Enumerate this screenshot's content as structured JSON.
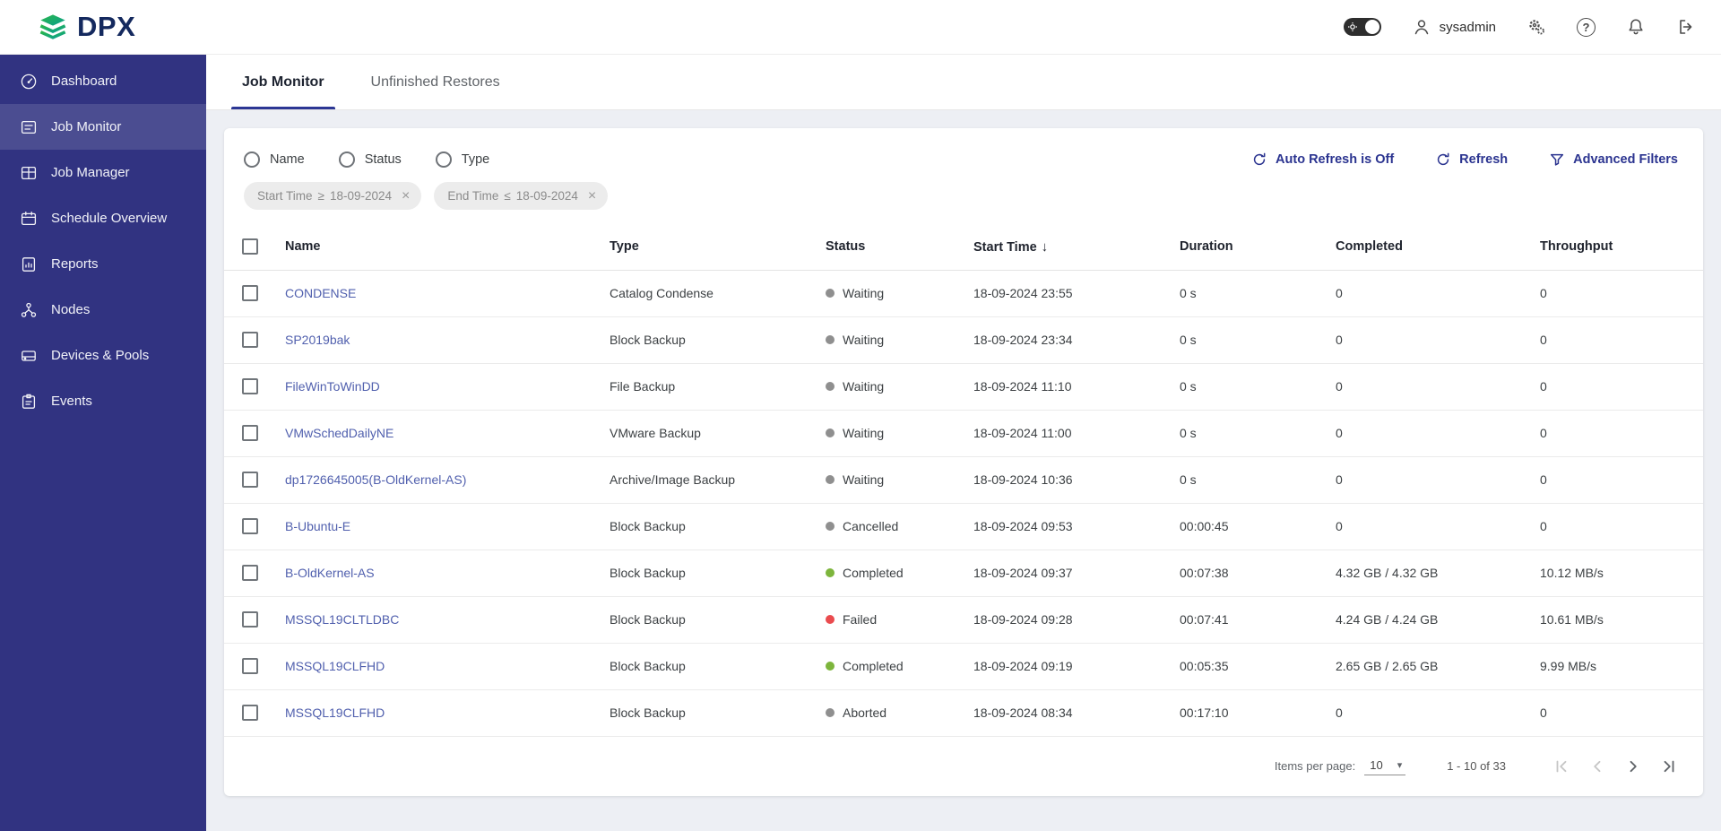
{
  "header": {
    "logo_text": "DPX",
    "username": "sysadmin"
  },
  "sidebar": {
    "items": [
      {
        "label": "Dashboard",
        "icon": "dashboard-icon",
        "state": ""
      },
      {
        "label": "Job Monitor",
        "icon": "job-monitor-icon",
        "state": "active"
      },
      {
        "label": "Job Manager",
        "icon": "job-manager-icon",
        "state": ""
      },
      {
        "label": "Schedule Overview",
        "icon": "schedule-overview-icon",
        "state": ""
      },
      {
        "label": "Reports",
        "icon": "reports-icon",
        "state": ""
      },
      {
        "label": "Nodes",
        "icon": "nodes-icon",
        "state": ""
      },
      {
        "label": "Devices & Pools",
        "icon": "devices-pools-icon",
        "state": ""
      },
      {
        "label": "Events",
        "icon": "events-icon",
        "state": ""
      }
    ]
  },
  "tabs": [
    {
      "label": "Job Monitor",
      "state": "active"
    },
    {
      "label": "Unfinished Restores",
      "state": ""
    }
  ],
  "toolbar": {
    "radios": [
      {
        "label": "Name"
      },
      {
        "label": "Status"
      },
      {
        "label": "Type"
      }
    ],
    "auto_refresh_label": "Auto Refresh is Off",
    "refresh_label": "Refresh",
    "advanced_filters_label": "Advanced Filters",
    "chips": [
      {
        "field": "Start Time",
        "operator": "≥",
        "value": "18-09-2024"
      },
      {
        "field": "End Time",
        "operator": "≤",
        "value": "18-09-2024"
      }
    ]
  },
  "table": {
    "columns": [
      "Name",
      "Type",
      "Status",
      "Start Time",
      "Duration",
      "Completed",
      "Throughput"
    ],
    "sort_column": "Start Time",
    "sort_direction": "desc",
    "rows": [
      {
        "name": "CONDENSE",
        "type": "Catalog Condense",
        "status": "Waiting",
        "status_color": "gray",
        "start_time": "18-09-2024 23:55",
        "duration": "0 s",
        "completed": "0",
        "throughput": "0"
      },
      {
        "name": "SP2019bak",
        "type": "Block Backup",
        "status": "Waiting",
        "status_color": "gray",
        "start_time": "18-09-2024 23:34",
        "duration": "0 s",
        "completed": "0",
        "throughput": "0"
      },
      {
        "name": "FileWinToWinDD",
        "type": "File Backup",
        "status": "Waiting",
        "status_color": "gray",
        "start_time": "18-09-2024 11:10",
        "duration": "0 s",
        "completed": "0",
        "throughput": "0"
      },
      {
        "name": "VMwSchedDailyNE",
        "type": "VMware Backup",
        "status": "Waiting",
        "status_color": "gray",
        "start_time": "18-09-2024 11:00",
        "duration": "0 s",
        "completed": "0",
        "throughput": "0"
      },
      {
        "name": "dp1726645005(B-OldKernel-AS)",
        "type": "Archive/Image Backup",
        "status": "Waiting",
        "status_color": "gray",
        "start_time": "18-09-2024 10:36",
        "duration": "0 s",
        "completed": "0",
        "throughput": "0"
      },
      {
        "name": "B-Ubuntu-E",
        "type": "Block Backup",
        "status": "Cancelled",
        "status_color": "gray",
        "start_time": "18-09-2024 09:53",
        "duration": "00:00:45",
        "completed": "0",
        "throughput": "0"
      },
      {
        "name": "B-OldKernel-AS",
        "type": "Block Backup",
        "status": "Completed",
        "status_color": "green",
        "start_time": "18-09-2024 09:37",
        "duration": "00:07:38",
        "completed": "4.32 GB / 4.32 GB",
        "throughput": "10.12 MB/s"
      },
      {
        "name": "MSSQL19CLTLDBC",
        "type": "Block Backup",
        "status": "Failed",
        "status_color": "red",
        "start_time": "18-09-2024 09:28",
        "duration": "00:07:41",
        "completed": "4.24 GB / 4.24 GB",
        "throughput": "10.61 MB/s"
      },
      {
        "name": "MSSQL19CLFHD",
        "type": "Block Backup",
        "status": "Completed",
        "status_color": "green",
        "start_time": "18-09-2024 09:19",
        "duration": "00:05:35",
        "completed": "2.65 GB / 2.65 GB",
        "throughput": "9.99 MB/s"
      },
      {
        "name": "MSSQL19CLFHD",
        "type": "Block Backup",
        "status": "Aborted",
        "status_color": "gray",
        "start_time": "18-09-2024 08:34",
        "duration": "00:17:10",
        "completed": "0",
        "throughput": "0"
      }
    ]
  },
  "pagination": {
    "items_per_page_label": "Items per page:",
    "items_per_page_value": "10",
    "range_label": "1 - 10 of 33"
  },
  "icons": {
    "sort_desc": "↓",
    "close": "×",
    "dropdown": "▾",
    "help": "?"
  },
  "colors": {
    "sidebar_bg": "#313381",
    "accent": "#2b3490",
    "link": "#5160ae",
    "status_gray": "#8f8f8f",
    "status_green": "#7db53c",
    "status_red": "#ea4b4e",
    "logo_green": "#2ab54b",
    "logo_teal": "#0aa08e"
  }
}
